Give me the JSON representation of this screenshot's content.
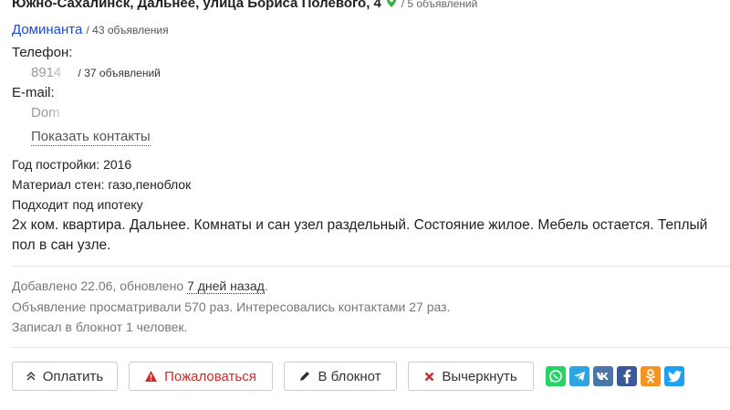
{
  "listing": {
    "address": "Южно-Сахалинск, Дальнее, улица Бориса Полевого, 4",
    "address_count": "/ 5 объявлений",
    "agency_name": "Доминанта",
    "agency_count": "/ 43 объявления",
    "phone_label": "Телефон:",
    "phone_value": "8914",
    "phone_count": "/ 37 объявлений",
    "email_label": "E-mail:",
    "email_value": "Dom",
    "show_contacts": "Показать контакты",
    "year_built": "Год постройки: 2016",
    "wall_material": "Материал стен: газо,пеноблок",
    "mortgage": "Подходит под ипотеку",
    "description": "2х ком. квартира. Дальнее. Комнаты и сан узел раздельный. Состояние жилое. Мебель остается. Теплый пол в сан узле."
  },
  "meta": {
    "added_prefix": "Добавлено 22.06, обновлено ",
    "updated_link": "7 дней назад",
    "added_suffix": ".",
    "views": "Объявление просматривали 570 раз. Интересовались контактами 27 раз.",
    "notepad": "Записал в блокнот 1 человек."
  },
  "actions": {
    "pay": "Оплатить",
    "complain": "Пожаловаться",
    "notepad": "В блокнот",
    "strike": "Вычеркнуть"
  },
  "social": [
    "whatsapp-icon",
    "telegram-icon",
    "vk-icon",
    "facebook-icon",
    "odnoklassniki-icon",
    "twitter-icon"
  ],
  "colors": {
    "link_blue": "#1a4bd3",
    "pin_green": "#3cb043",
    "complain_red": "#d42727",
    "whatsapp": "#25d366",
    "telegram": "#2ca5e0",
    "vk": "#4a76a8",
    "facebook": "#3b5998",
    "odnoklassniki": "#f7931e",
    "twitter": "#1da1f2"
  }
}
